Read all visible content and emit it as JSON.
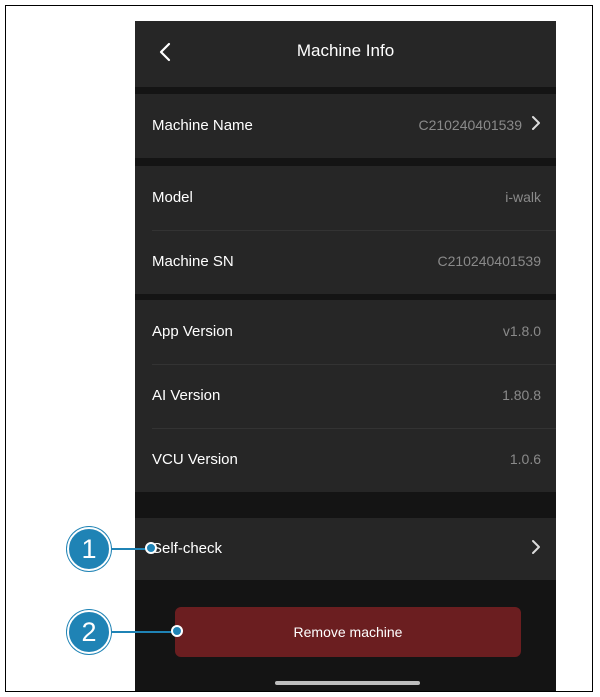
{
  "header": {
    "title": "Machine Info"
  },
  "rows": {
    "machine_name": {
      "label": "Machine Name",
      "value": "C210240401539"
    },
    "model": {
      "label": "Model",
      "value": "i-walk"
    },
    "machine_sn": {
      "label": "Machine SN",
      "value": "C210240401539"
    },
    "app_version": {
      "label": "App Version",
      "value": "v1.8.0"
    },
    "ai_version": {
      "label": "AI Version",
      "value": "1.80.8"
    },
    "vcu_version": {
      "label": "VCU Version",
      "value": "1.0.6"
    },
    "self_check": {
      "label": "Self-check"
    }
  },
  "actions": {
    "remove_label": "Remove machine"
  },
  "callouts": {
    "one": "1",
    "two": "2"
  },
  "colors": {
    "accent": "#1f83b5",
    "danger": "#6b1e20",
    "background": "#141414",
    "surface": "#262626"
  },
  "icons": {
    "back": "chevron-left-icon",
    "row_arrow": "chevron-right-icon"
  }
}
